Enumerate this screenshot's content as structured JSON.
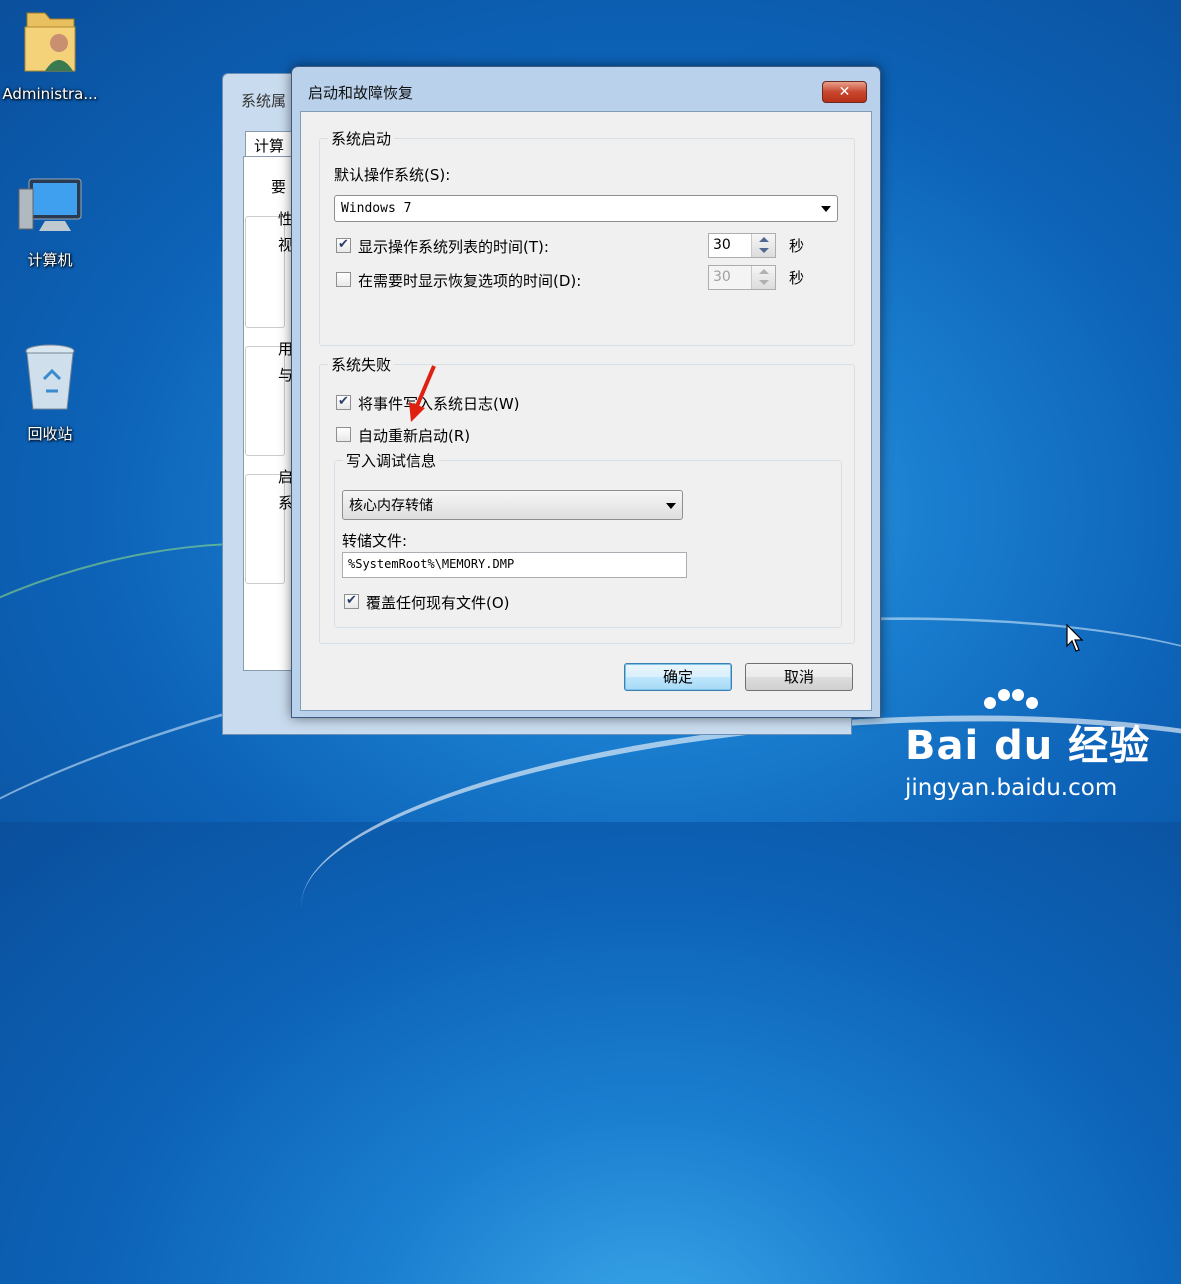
{
  "desktop": {
    "icons": [
      {
        "label": "Administra...",
        "icon": "user-folder-icon"
      },
      {
        "label": "计算机",
        "icon": "computer-icon"
      },
      {
        "label": "回收站",
        "icon": "recycle-bin-icon"
      }
    ]
  },
  "back_window": {
    "title": "系统属",
    "tab": "计算",
    "fragments": [
      "要",
      "性",
      "视",
      "用",
      "与",
      "启",
      "系"
    ]
  },
  "dialog": {
    "title": "启动和故障恢复",
    "close_label": "✕",
    "startup": {
      "legend": "系统启动",
      "default_os_label": "默认操作系统(S):",
      "default_os_value": "Windows 7",
      "show_list": {
        "label": "显示操作系统列表的时间(T):",
        "checked": true,
        "value": "30",
        "unit": "秒"
      },
      "show_recovery": {
        "label": "在需要时显示恢复选项的时间(D):",
        "checked": false,
        "value": "30",
        "unit": "秒"
      }
    },
    "failure": {
      "legend": "系统失败",
      "write_event": {
        "label": "将事件写入系统日志(W)",
        "checked": true
      },
      "auto_restart": {
        "label": "自动重新启动(R)",
        "checked": false
      },
      "debug": {
        "legend": "写入调试信息",
        "dump_type": "核心内存转储",
        "dump_file_label": "转储文件:",
        "dump_file_value": "%SystemRoot%\\MEMORY.DMP",
        "overwrite": {
          "label": "覆盖任何现有文件(O)",
          "checked": true
        }
      }
    },
    "ok_label": "确定",
    "cancel_label": "取消"
  },
  "watermark": {
    "brand": "Bai du 经验",
    "url": "jingyan.baidu.com"
  },
  "colors": {
    "desktop": "#0d63b8",
    "annotation_arrow": "#e02010",
    "close_button": "#c8472e"
  }
}
